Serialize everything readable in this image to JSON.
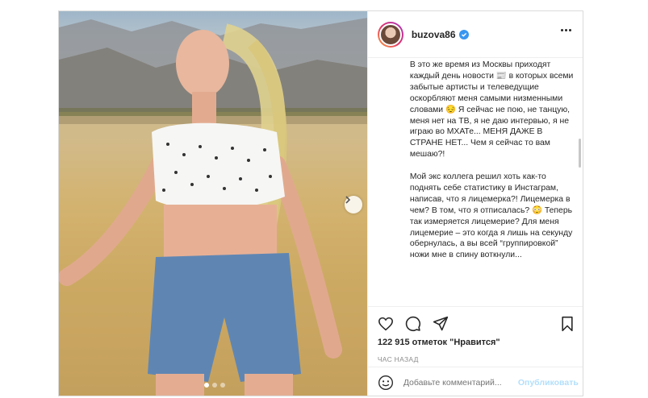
{
  "post": {
    "username": "buzova86",
    "verified": true,
    "caption_paragraphs": [
      "В это же время из Москвы приходят каждый день новости 📰 в которых всеми забытые артисты и телеведущие оскорбляют меня самыми низменными словами 😔 Я сейчас не пою, не танцую, меня нет на ТВ, я не даю интервью, я не играю во МХАТе... МЕНЯ ДАЖЕ В СТРАНЕ НЕТ... Чем я сейчас то вам мешаю?!",
      "Мой экс коллега решил хоть как-то поднять себе статистику в Инстаграм, написав, что я лицемерка?! Лицемерка в чем? В том, что я отписалась? 😳 Теперь так измеряется лицемерие? Для меня лицемерие – это когда я лишь на секунду обернулась, а вы всей “группировкой” ножи мне в спину воткнули..."
    ],
    "likes_text": "122 915 отметок \"Нравится\"",
    "timestamp": "ЧАС НАЗАД",
    "comment_placeholder": "Добавьте комментарий...",
    "publish_label": "Опубликовать"
  },
  "icons": {
    "like": "heart-icon",
    "comment": "comment-icon",
    "share": "paper-plane-icon",
    "save": "bookmark-icon",
    "emoji": "smiley-icon",
    "more": "more-options-icon",
    "next": "chevron-right-icon"
  },
  "carousel": {
    "slides": 3,
    "active_index": 0
  },
  "colors": {
    "verified_badge": "#3897f0",
    "publish_disabled": "#b2dffc",
    "secondary_text": "#8e8e8e"
  }
}
